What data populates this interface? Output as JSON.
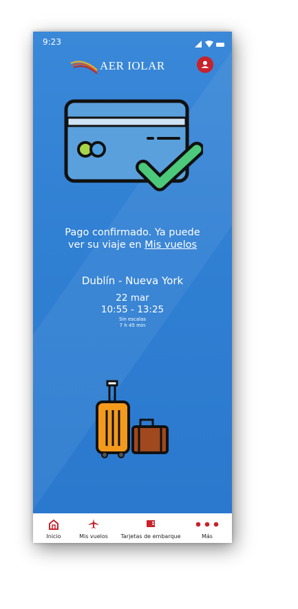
{
  "status_bar": {
    "time": "9:23"
  },
  "header": {
    "brand": "AER IOLAR"
  },
  "message": {
    "line1": "Pago confirmado. Ya puede",
    "line2_prefix": "ver su viaje en ",
    "link": "Mis vuelos"
  },
  "flight": {
    "route": "Dublín - Nueva York",
    "date": "22 mar",
    "times": "10:55 - 13:25",
    "stops": "Sin escalas",
    "duration": "7 h 45 min"
  },
  "nav": [
    {
      "label": "Inicio",
      "icon": "home-icon"
    },
    {
      "label": "Mis vuelos",
      "icon": "plane-icon"
    },
    {
      "label": "Tarjetas de embarque",
      "icon": "boarding-pass-icon"
    },
    {
      "label": "Más",
      "icon": "more-dots-icon"
    }
  ],
  "colors": {
    "background": "#2f7fd3",
    "brand_red": "#c8222b",
    "check_green": "#4cc97a"
  }
}
